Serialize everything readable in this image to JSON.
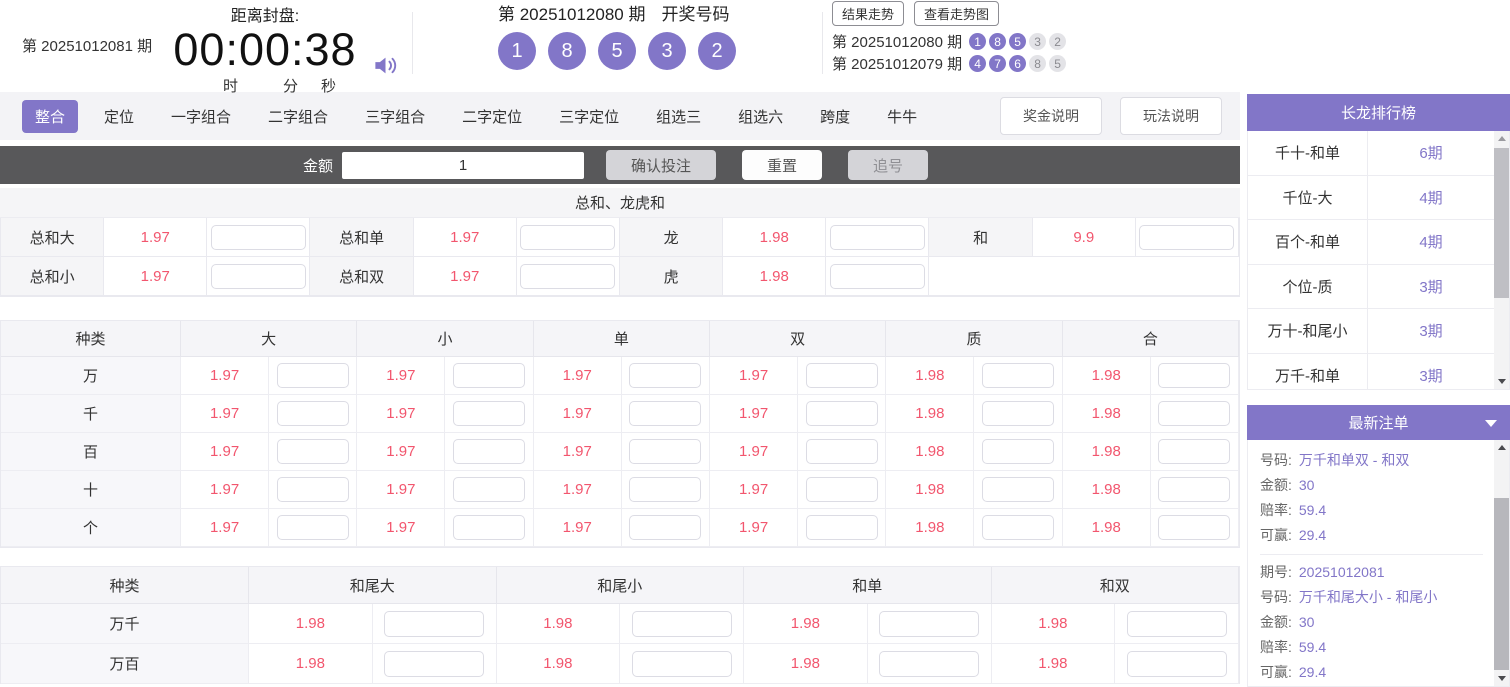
{
  "colors": {
    "accent": "#8276c8",
    "odds_red": "#f2566e",
    "toolbar_dark": "#58585a",
    "ball_inactive": "#e3e3e7"
  },
  "header": {
    "current_period_label": "第 20251012081 期",
    "countdown": {
      "label": "距离封盘:",
      "time": "00:00:38",
      "units": [
        "时",
        "分",
        "秒"
      ]
    },
    "draw": {
      "period_label": "第 20251012080 期",
      "title": "开奖号码",
      "numbers": [
        "1",
        "8",
        "5",
        "3",
        "2"
      ]
    },
    "trend_buttons": [
      "结果走势",
      "查看走势图"
    ],
    "history": [
      {
        "period_label": "第 20251012080 期",
        "numbers": [
          "1",
          "8",
          "5",
          "3",
          "2"
        ],
        "highlighted_count": 3
      },
      {
        "period_label": "第 20251012079 期",
        "numbers": [
          "4",
          "7",
          "6",
          "8",
          "5"
        ],
        "highlighted_count": 3
      }
    ]
  },
  "tabs": {
    "items": [
      "整合",
      "定位",
      "一字组合",
      "二字组合",
      "三字组合",
      "二字定位",
      "三字定位",
      "组选三",
      "组选六",
      "跨度",
      "牛牛"
    ],
    "active": "整合",
    "help_buttons": [
      "奖金说明",
      "玩法说明"
    ]
  },
  "bet_bar": {
    "amount_label": "金额",
    "amount_value": "1",
    "buttons": [
      "确认投注",
      "重置",
      "追号"
    ]
  },
  "sum_section": {
    "title": "总和、龙虎和",
    "rows": [
      [
        {
          "label": "总和大",
          "odds": "1.97"
        },
        {
          "label": "总和单",
          "odds": "1.97"
        },
        {
          "label": "龙",
          "odds": "1.98"
        },
        {
          "label": "和",
          "odds": "9.9"
        }
      ],
      [
        {
          "label": "总和小",
          "odds": "1.97"
        },
        {
          "label": "总和双",
          "odds": "1.97"
        },
        {
          "label": "虎",
          "odds": "1.98"
        }
      ]
    ]
  },
  "position_table": {
    "headers": [
      "种类",
      "大",
      "小",
      "单",
      "双",
      "质",
      "合"
    ],
    "rows": [
      {
        "label": "万",
        "odds": [
          "1.97",
          "1.97",
          "1.97",
          "1.97",
          "1.98",
          "1.98"
        ]
      },
      {
        "label": "千",
        "odds": [
          "1.97",
          "1.97",
          "1.97",
          "1.97",
          "1.98",
          "1.98"
        ]
      },
      {
        "label": "百",
        "odds": [
          "1.97",
          "1.97",
          "1.97",
          "1.97",
          "1.98",
          "1.98"
        ]
      },
      {
        "label": "十",
        "odds": [
          "1.97",
          "1.97",
          "1.97",
          "1.97",
          "1.98",
          "1.98"
        ]
      },
      {
        "label": "个",
        "odds": [
          "1.97",
          "1.97",
          "1.97",
          "1.97",
          "1.98",
          "1.98"
        ]
      }
    ]
  },
  "tail_table": {
    "headers": [
      "种类",
      "和尾大",
      "和尾小",
      "和单",
      "和双"
    ],
    "rows": [
      {
        "label": "万千",
        "odds": [
          "1.98",
          "1.98",
          "1.98",
          "1.98"
        ]
      },
      {
        "label": "万百",
        "odds": [
          "1.98",
          "1.98",
          "1.98",
          "1.98"
        ]
      }
    ]
  },
  "sidebar": {
    "ranking": {
      "title": "长龙排行榜",
      "rows": [
        {
          "label": "千十-和单",
          "value": "6期"
        },
        {
          "label": "千位-大",
          "value": "4期"
        },
        {
          "label": "百个-和单",
          "value": "4期"
        },
        {
          "label": "个位-质",
          "value": "3期"
        },
        {
          "label": "万十-和尾小",
          "value": "3期"
        },
        {
          "label": "万千-和单",
          "value": "3期"
        }
      ]
    },
    "orders": {
      "title": "最新注单",
      "entries": [
        {
          "lines": [
            {
              "label": "号码:",
              "value": "万千和单双 - 和双"
            },
            {
              "label": "金额:",
              "value": "30"
            },
            {
              "label": "赔率:",
              "value": "59.4"
            },
            {
              "label": "可赢:",
              "value": "29.4"
            }
          ]
        },
        {
          "lines": [
            {
              "label": "期号:",
              "value": "20251012081"
            },
            {
              "label": "号码:",
              "value": "万千和尾大小 - 和尾小"
            },
            {
              "label": "金额:",
              "value": "30"
            },
            {
              "label": "赔率:",
              "value": "59.4"
            },
            {
              "label": "可赢:",
              "value": "29.4"
            }
          ]
        }
      ]
    }
  }
}
